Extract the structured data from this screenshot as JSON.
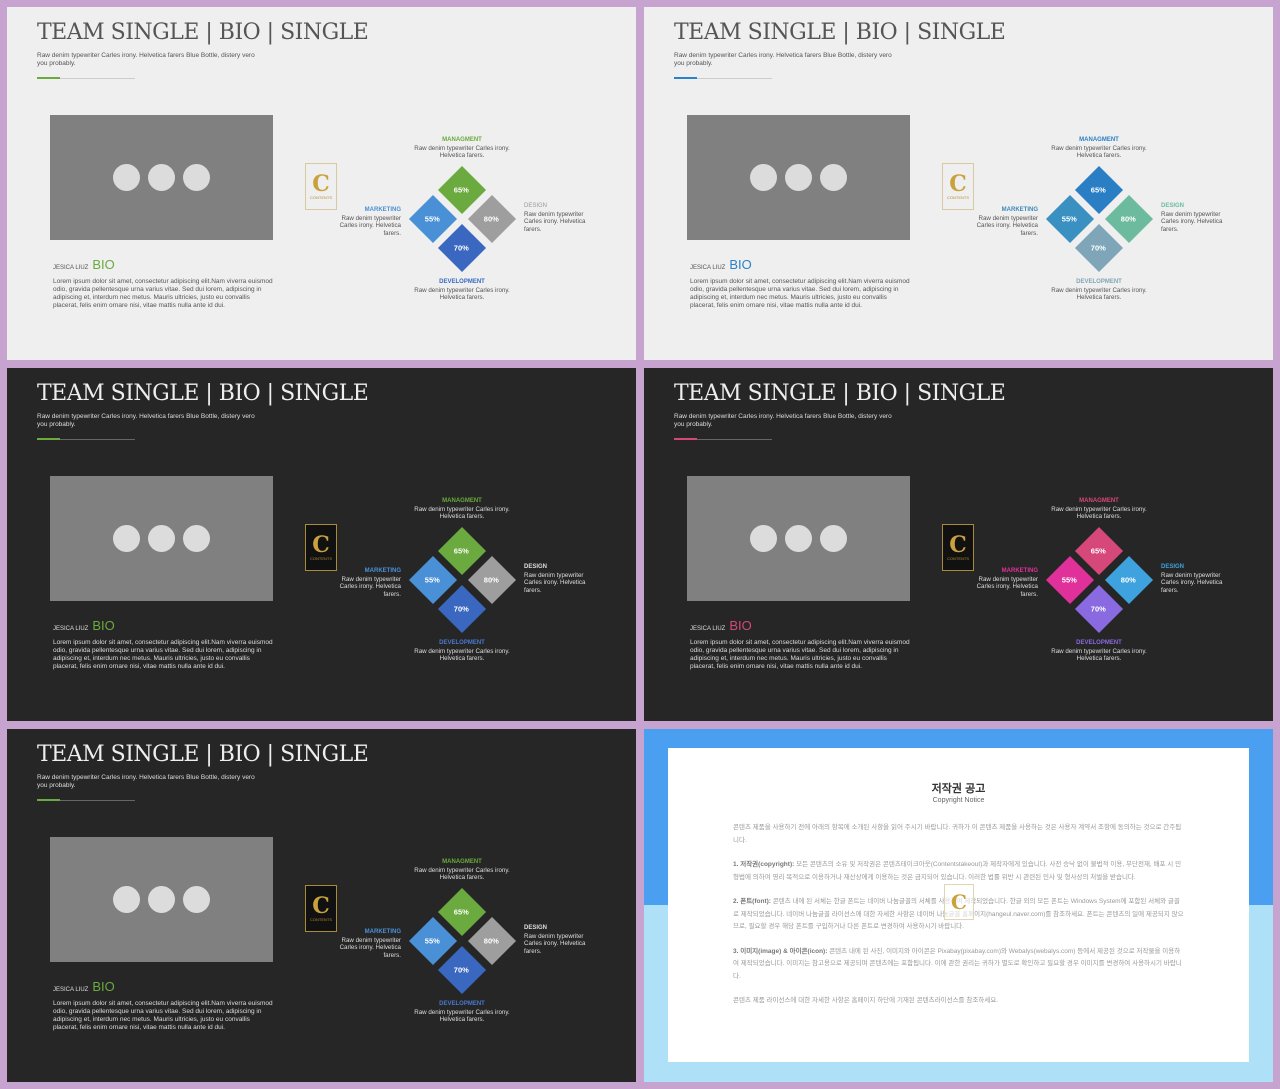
{
  "slides": [
    {
      "theme": "light",
      "accent": "#6aaa3e",
      "title": "TEAM SINGLE | BIO | SINGLE",
      "subtitle": "Raw denim typewriter Carles irony. Helvetica farers Blue Bottle, distery vero you probably.",
      "name": "JESICA LIUZ",
      "bio": "BIO",
      "lorem": "Lorem ipsum dolor sit amet, consectetur adipiscing elit.Nam viverra euismod odio, gravida pellentesque urna varius vitae. Sed dui lorem, adipiscing in adipiscing et, interdum nec metus. Mauris ultricies, justo eu convallis placerat, felis enim ornare nisi, vitae mattis nulla ante id dui.",
      "logo": {
        "letter": "C",
        "text": "CONTENTS"
      },
      "skills": [
        {
          "label": "MANAGMENT",
          "desc": "Raw denim typewriter Carles irony. Helvetica farers.",
          "value": "65%",
          "color": "#6aaa3e",
          "label_color": "#6aaa3e"
        },
        {
          "label": "MARKETING",
          "desc": "Raw denim typewriter Carles irony. Helvetica farers.",
          "value": "55%",
          "color": "#4a90d6",
          "label_color": "#4a90d6"
        },
        {
          "label": "DESIGN",
          "desc": "Raw denim typewriter Carles irony. Helvetica farers.",
          "value": "80%",
          "color": "#9e9e9e",
          "label_color": "#999999"
        },
        {
          "label": "DEVELOPMENT",
          "desc": "Raw denim typewriter Carles irony. Helvetica farers.",
          "value": "70%",
          "color": "#3a68c0",
          "label_color": "#3a68c0"
        }
      ]
    },
    {
      "theme": "light",
      "accent": "#2a82c8",
      "title": "TEAM SINGLE | BIO | SINGLE",
      "subtitle": "Raw denim typewriter Carles irony. Helvetica farers Blue Bottle, distery vero you probably.",
      "name": "JESICA LIUZ",
      "bio": "BIO",
      "lorem": "Lorem ipsum dolor sit amet, consectetur adipiscing elit.Nam viverra euismod odio, gravida pellentesque urna varius vitae. Sed dui lorem, adipiscing in adipiscing et, interdum nec metus. Mauris ultricies, justo eu convallis placerat, felis enim ornare nisi, vitae mattis nulla ante id dui.",
      "logo": {
        "letter": "C",
        "text": "CONTENTS"
      },
      "skills": [
        {
          "label": "MANAGMENT",
          "desc": "Raw denim typewriter Carles irony. Helvetica farers.",
          "value": "65%",
          "color": "#2a7fc4",
          "label_color": "#2a7fc4"
        },
        {
          "label": "MARKETING",
          "desc": "Raw denim typewriter Carles irony. Helvetica farers.",
          "value": "55%",
          "color": "#3a90c0",
          "label_color": "#3a8ab8"
        },
        {
          "label": "DESIGN",
          "desc": "Raw denim typewriter Carles irony. Helvetica farers.",
          "value": "80%",
          "color": "#6dbb9e",
          "label_color": "#6dbb9e"
        },
        {
          "label": "DEVELOPMENT",
          "desc": "Raw denim typewriter Carles irony. Helvetica farers.",
          "value": "70%",
          "color": "#7fa6b8",
          "label_color": "#7fa6b8"
        }
      ]
    },
    {
      "theme": "dark",
      "accent": "#6aaa3e",
      "title": "TEAM SINGLE | BIO | SINGLE",
      "subtitle": "Raw denim typewriter Carles irony. Helvetica farers Blue Bottle, distery vero you probably.",
      "name": "JESICA LIUZ",
      "bio": "BIO",
      "lorem": "Lorem ipsum dolor sit amet, consectetur adipiscing elit.Nam viverra euismod odio, gravida pellentesque urna varius vitae. Sed dui lorem, adipiscing in adipiscing et, interdum nec metus. Mauris ultricies, justo eu convallis placerat, felis enim ornare nisi, vitae mattis nulla ante id dui.",
      "logo": {
        "letter": "C",
        "text": "CONTENTS"
      },
      "skills": [
        {
          "label": "MANAGMENT",
          "desc": "Raw denim typewriter Carles irony. Helvetica farers.",
          "value": "65%",
          "color": "#6aaa3e",
          "label_color": "#6aaa3e"
        },
        {
          "label": "MARKETING",
          "desc": "Raw denim typewriter Carles irony. Helvetica farers.",
          "value": "55%",
          "color": "#4a90d6",
          "label_color": "#4a90d6"
        },
        {
          "label": "DESIGN",
          "desc": "Raw denim typewriter Carles irony. Helvetica farers.",
          "value": "80%",
          "color": "#9e9e9e",
          "label_color": "#dddddd"
        },
        {
          "label": "DEVELOPMENT",
          "desc": "Raw denim typewriter Carles irony. Helvetica farers.",
          "value": "70%",
          "color": "#3a68c0",
          "label_color": "#4a78d0"
        }
      ]
    },
    {
      "theme": "dark",
      "accent": "#d6477a",
      "title": "TEAM SINGLE | BIO | SINGLE",
      "subtitle": "Raw denim typewriter Carles irony. Helvetica farers Blue Bottle, distery vero you probably.",
      "name": "JESICA LIUZ",
      "bio": "BIO",
      "lorem": "Lorem ipsum dolor sit amet, consectetur adipiscing elit.Nam viverra euismod odio, gravida pellentesque urna varius vitae. Sed dui lorem, adipiscing in adipiscing et, interdum nec metus. Mauris ultricies, justo eu convallis placerat, felis enim ornare nisi, vitae mattis nulla ante id dui.",
      "logo": {
        "letter": "C",
        "text": "CONTENTS"
      },
      "skills": [
        {
          "label": "MANAGMENT",
          "desc": "Raw denim typewriter Carles irony. Helvetica farers.",
          "value": "65%",
          "color": "#d6477a",
          "label_color": "#d6477a"
        },
        {
          "label": "MARKETING",
          "desc": "Raw denim typewriter Carles irony. Helvetica farers.",
          "value": "55%",
          "color": "#e0309a",
          "label_color": "#e0309a"
        },
        {
          "label": "DESIGN",
          "desc": "Raw denim typewriter Carles irony. Helvetica farers.",
          "value": "80%",
          "color": "#3ea2de",
          "label_color": "#3ea2de"
        },
        {
          "label": "DEVELOPMENT",
          "desc": "Raw denim typewriter Carles irony. Helvetica farers.",
          "value": "70%",
          "color": "#8a6ae0",
          "label_color": "#8a6ae0"
        }
      ]
    },
    {
      "theme": "dark",
      "accent": "#6aaa3e",
      "title": "TEAM SINGLE | BIO | SINGLE",
      "subtitle": "Raw denim typewriter Carles irony. Helvetica farers Blue Bottle, distery vero you probably.",
      "name": "JESICA LIUZ",
      "bio": "BIO",
      "lorem": "Lorem ipsum dolor sit amet, consectetur adipiscing elit.Nam viverra euismod odio, gravida pellentesque urna varius vitae. Sed dui lorem, adipiscing in adipiscing et, interdum nec metus. Mauris ultricies, justo eu convallis placerat, felis enim ornare nisi, vitae mattis nulla ante id dui.",
      "logo": {
        "letter": "C",
        "text": "CONTENTS"
      },
      "skills": [
        {
          "label": "MANAGMENT",
          "desc": "Raw denim typewriter Carles irony. Helvetica farers.",
          "value": "65%",
          "color": "#6aaa3e",
          "label_color": "#6aaa3e"
        },
        {
          "label": "MARKETING",
          "desc": "Raw denim typewriter Carles irony. Helvetica farers.",
          "value": "55%",
          "color": "#4a90d6",
          "label_color": "#4a90d6"
        },
        {
          "label": "DESIGN",
          "desc": "Raw denim typewriter Carles irony. Helvetica farers.",
          "value": "80%",
          "color": "#9e9e9e",
          "label_color": "#dddddd"
        },
        {
          "label": "DEVELOPMENT",
          "desc": "Raw denim typewriter Carles irony. Helvetica farers.",
          "value": "70%",
          "color": "#3a68c0",
          "label_color": "#4a78d0"
        }
      ]
    }
  ],
  "copyright": {
    "title": "저작권 공고",
    "subtitle": "Copyright Notice",
    "logo_letter": "C",
    "intro": "콘텐츠 제품을 사용하기 전에 아래의 항목에 소개된 사항을 읽어 주시기 바랍니다. 귀하가 이 콘텐츠 제품을 사용하는 것은 사용자 계약서 조항에 동의하는 것으로 간주됩니다.",
    "items": [
      {
        "head": "1. 저작권(copyright):",
        "text": " 모든 콘텐츠의 소유 및 저작권은 콘텐츠테이크아웃(Contentstakeout)과 제작자에게 있습니다. 사전 승낙 없이 불법적 이용, 무단전재, 배포 시 민형법에 의하여 영리 목적으로 이용하거나 재산상에게 이용하는 것은 금지되어 있습니다. 이러한 법률 위반 시 관련된 민사 및 형사상의 처벌을 받습니다."
      },
      {
        "head": "2. 폰트(font):",
        "text": " 콘텐츠 내에 된 서체는 한글 폰트는 네이버 나눔글꼴의 서체를 사용하여 제작되었습니다. 한글 외의 모든 폰트는 Windows System에 포함된 서체와 글꼴로 제작되었습니다. 네이버 나눔글꼴 라이선스에 대한 자세한 사항은 네이버 나눔글꼴 홈페이지(hangeul.naver.com)를 참조하세요. 폰트는 콘텐츠의 일에 제공되지 않으므로, 필요할 경우 해당 폰트를 구입하거나 다른 폰트로 변경하여 사용하시기 바랍니다."
      },
      {
        "head": "3. 이미지(image) & 아이콘(icon):",
        "text": " 콘텐츠 내에 된 사진, 이미지와 아이콘은 Pixabay(pixabay.com)와 Webalys(webalys.com) 등에서 제공된 것으로 저작물을 이용하여 제작되었습니다. 이미지는 참고용으로 제공되며 콘텐츠에는 포함됩니다. 이에 관한 권리는 귀하가 별도로 확인하고 필요할 경우 이미지를 변경하여 사용하시기 바랍니다."
      }
    ],
    "outro": "콘텐츠 제품 라이선스에 대한 자세한 사항은 홈페이지 하단에 기재된 콘텐츠라이선스를 참조하세요."
  }
}
